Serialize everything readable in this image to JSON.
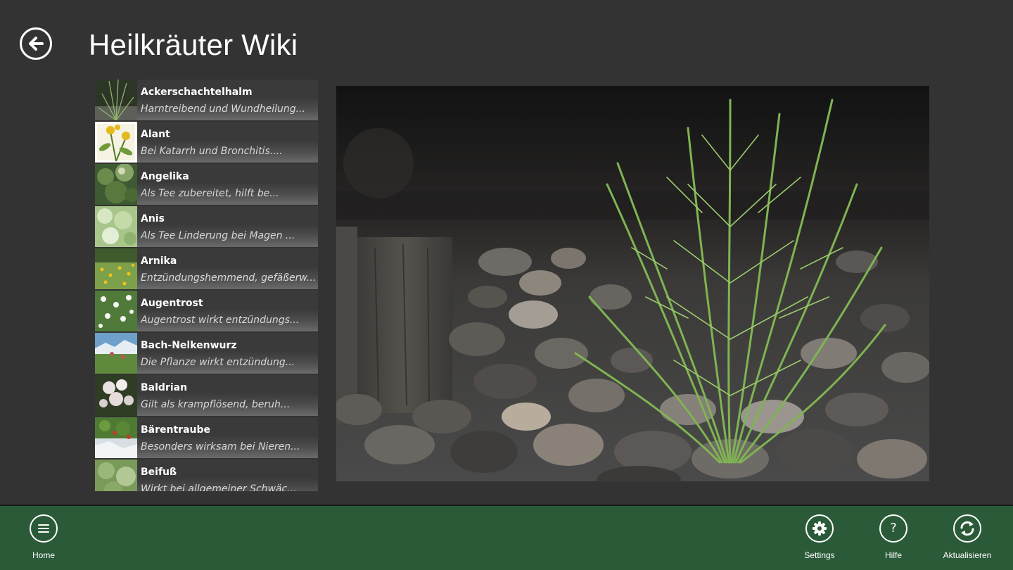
{
  "header": {
    "title": "Heilkräuter Wiki",
    "back_icon": "back-arrow-icon"
  },
  "herbs": [
    {
      "name": "Ackerschachtelhalm",
      "desc": "Harntreibend und Wundheilung..."
    },
    {
      "name": "Alant",
      "desc": "Bei Katarrh und Bronchitis...."
    },
    {
      "name": "Angelika",
      "desc": "Als Tee zubereitet, hilft be..."
    },
    {
      "name": "Anis",
      "desc": "Als Tee Linderung bei Magen ..."
    },
    {
      "name": "Arnika",
      "desc": "Entzündungshemmend, gefäßerw..."
    },
    {
      "name": "Augentrost",
      "desc": "Augentrost wirkt entzündungs..."
    },
    {
      "name": "Bach-Nelkenwurz",
      "desc": "Die Pflanze wirkt entzündung..."
    },
    {
      "name": "Baldrian",
      "desc": "Gilt als krampflösend, beruh..."
    },
    {
      "name": "Bärentraube",
      "desc": "Besonders wirksam bei Nieren..."
    },
    {
      "name": "Beifuß",
      "desc": "Wirkt bei allgemeiner Schwäc..."
    }
  ],
  "appbar": {
    "home": {
      "label": "Home",
      "icon": "menu-icon"
    },
    "settings": {
      "label": "Settings",
      "icon": "gear-icon"
    },
    "help": {
      "label": "Hilfe",
      "icon": "help-icon"
    },
    "refresh": {
      "label": "Aktualisieren",
      "icon": "refresh-icon"
    }
  },
  "colors": {
    "background": "#333333",
    "appbar": "#2a5a37",
    "text": "#ffffff"
  }
}
